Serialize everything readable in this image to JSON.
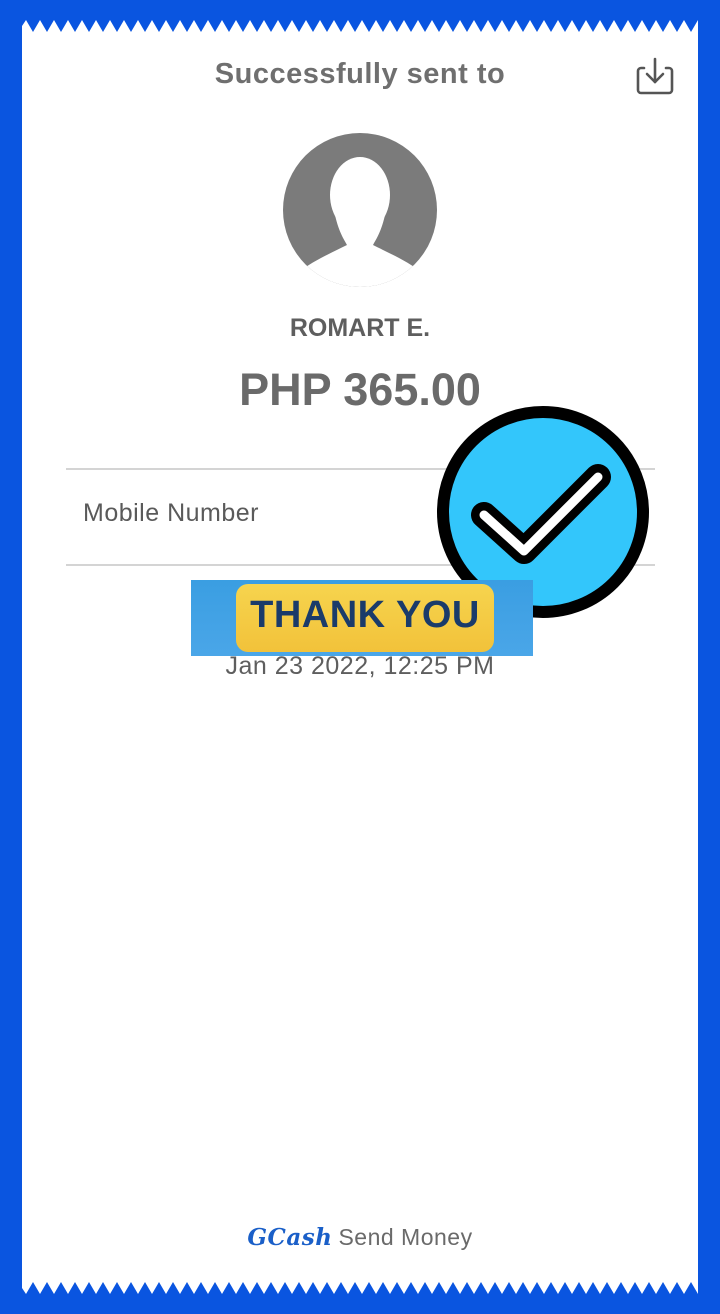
{
  "header": {
    "title": "Successfully sent to",
    "download_icon": "download-icon"
  },
  "recipient": {
    "avatar_icon": "person-silhouette-icon",
    "name": "ROMART E."
  },
  "transaction": {
    "amount": "PHP 365.00",
    "mobile_label": "Mobile Number",
    "datetime": "Jan 23 2022, 12:25 PM"
  },
  "overlay": {
    "check_icon": "check-circle-icon",
    "thank_you_text": "THANK YOU"
  },
  "footer": {
    "brand": "GCash",
    "service": "Send Money"
  },
  "colors": {
    "background": "#0a55e0",
    "check_fill": "#33c6fb",
    "thank_you_yellow": "#f4c942",
    "brand_blue": "#1a5fc8"
  }
}
